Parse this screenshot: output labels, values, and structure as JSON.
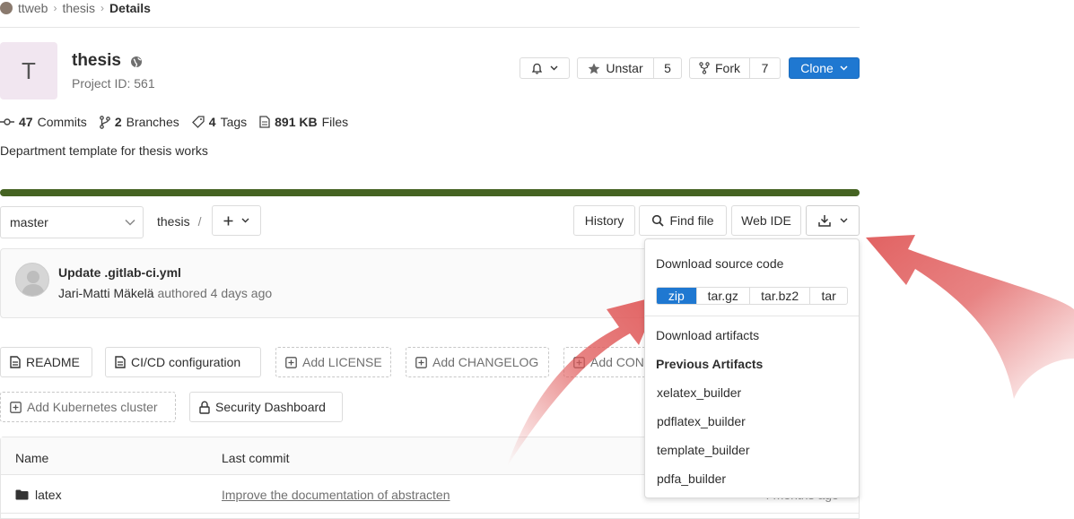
{
  "breadcrumb": {
    "group": "ttweb",
    "project": "thesis",
    "current": "Details"
  },
  "project": {
    "avatar_letter": "T",
    "name": "thesis",
    "id_label": "Project ID: 561",
    "description": "Department template for thesis works"
  },
  "actions": {
    "unstar_label": "Unstar",
    "star_count": "5",
    "fork_label": "Fork",
    "fork_count": "7",
    "clone_label": "Clone"
  },
  "stats": {
    "commits_count": "47",
    "commits_label": "Commits",
    "branches_count": "2",
    "branches_label": "Branches",
    "tags_count": "4",
    "tags_label": "Tags",
    "files_size": "891 KB",
    "files_label": "Files"
  },
  "progress": {
    "percent": 100,
    "color": "#456322"
  },
  "tree": {
    "branch": "master",
    "path": "thesis",
    "slash": "/",
    "history_label": "History",
    "find_file_label": "Find file",
    "web_ide_label": "Web IDE"
  },
  "last_commit": {
    "title": "Update .gitlab-ci.yml",
    "author": "Jari-Matti Mäkelä",
    "authored": "authored 4 days ago"
  },
  "quick_buttons": {
    "readme": "README",
    "cicd": "CI/CD configuration",
    "license": "Add LICENSE",
    "changelog": "Add CHANGELOG",
    "contributing": "Add CON",
    "kubernetes": "Add Kubernetes cluster",
    "security": "Security Dashboard"
  },
  "table": {
    "headers": {
      "name": "Name",
      "last_commit": "Last commit"
    },
    "rows": [
      {
        "name": "latex",
        "commit": "Improve the documentation of abstracten",
        "date": "4 months ago"
      }
    ]
  },
  "download_dropdown": {
    "source_heading": "Download source code",
    "formats": [
      "zip",
      "tar.gz",
      "tar.bz2",
      "tar"
    ],
    "selected_format": "zip",
    "artifacts_heading": "Download artifacts",
    "previous_heading": "Previous Artifacts",
    "artifacts": [
      "xelatex_builder",
      "pdflatex_builder",
      "template_builder",
      "pdfa_builder"
    ]
  },
  "colors": {
    "accent_blue": "#1f78d1",
    "annotation_arrow": "#e05a5a"
  }
}
